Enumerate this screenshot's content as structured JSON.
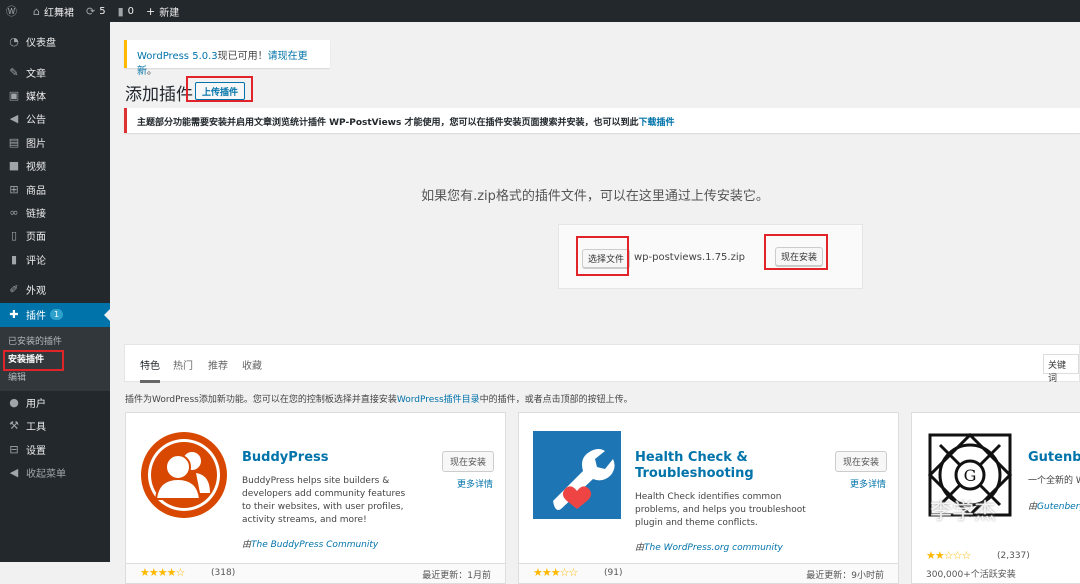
{
  "adminbar": {
    "site_name": "红舞裙",
    "updates_count": "5",
    "comments_count": "0",
    "new_label": "新建"
  },
  "sidebar": {
    "items": [
      {
        "label": "仪表盘"
      },
      {
        "label": "文章"
      },
      {
        "label": "媒体"
      },
      {
        "label": "公告"
      },
      {
        "label": "图片"
      },
      {
        "label": "视频"
      },
      {
        "label": "商品"
      },
      {
        "label": "链接"
      },
      {
        "label": "页面"
      },
      {
        "label": "评论"
      },
      {
        "label": "外观"
      },
      {
        "label": "插件"
      }
    ],
    "plugins_badge": "1",
    "submenu": [
      "已安装的插件",
      "安装插件",
      "编辑"
    ],
    "bottom": [
      {
        "label": "用户"
      },
      {
        "label": "工具"
      },
      {
        "label": "设置"
      },
      {
        "label": "收起菜单"
      }
    ]
  },
  "notice": {
    "version_link": "WordPress 5.0.3",
    "middle": "现已可用！",
    "update_link": "请现在更新",
    "end": "。"
  },
  "page": {
    "title": "添加插件",
    "upload_button": "上传插件"
  },
  "error": {
    "text": "主题部分功能需要安装并启用文章浏览统计插件 WP-PostViews 才能使用，您可以在插件安装页面搜索并安装，也可以到此",
    "link": "下载插件"
  },
  "upload": {
    "help": "如果您有.zip格式的插件文件，可以在这里通过上传安装它。",
    "choose_button": "选择文件",
    "file_name": "wp-postviews.1.75.zip",
    "install_button": "现在安装"
  },
  "filter": {
    "tabs": [
      "特色",
      "热门",
      "推荐",
      "收藏"
    ],
    "search_placeholder": "关键词"
  },
  "description": {
    "before": "插件为WordPress添加新功能。您可以在您的控制板选择并直接安装",
    "link": "WordPress插件目录",
    "after": "中的插件，或者点击顶部的按钮上传。"
  },
  "plugins": [
    {
      "name": "BuddyPress",
      "text": "BuddyPress helps site builders & developers add community features to their websites, with user profiles, activity streams, and more!",
      "by_prefix": "由",
      "author": "The BuddyPress Community",
      "install": "现在安装",
      "more": "更多详情",
      "rating": "(318)",
      "updated": "最近更新：1月前"
    },
    {
      "name": "Health Check & Troubleshooting",
      "text": "Health Check identifies common problems, and helps you troubleshoot plugin and theme conflicts.",
      "by_prefix": "由",
      "author": "The WordPress.org community",
      "install": "现在安装",
      "more": "更多详情",
      "rating": "(91)",
      "updated": "最近更新：9小时前"
    },
    {
      "name": "Gutenbe",
      "text": "一个全新的 W",
      "by_prefix": "由",
      "author": "Gutenberg",
      "rating": "(2,337)",
      "installs": "300,000+个活跃安装"
    }
  ],
  "watermark": "李学杰"
}
